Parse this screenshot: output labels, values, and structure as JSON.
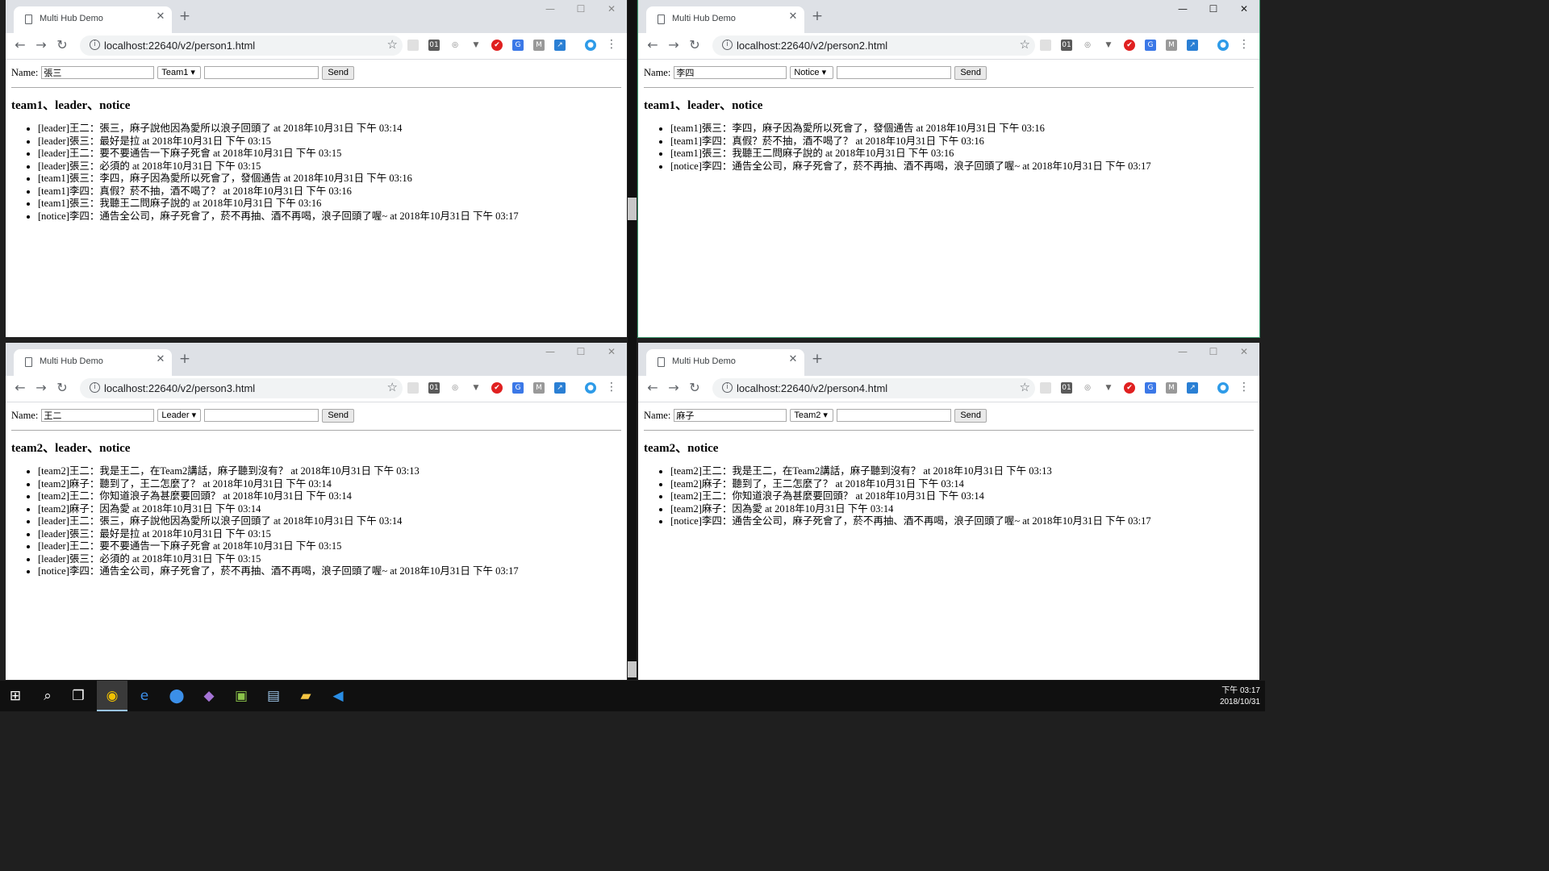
{
  "windows": [
    {
      "tab_title": "Multi Hub Demo",
      "url": "localhost:22640/v2/person1.html",
      "name_label": "Name:",
      "name_value": "張三",
      "group_selected": "Team1",
      "send_label": "Send",
      "heading": "team1、leader、notice",
      "messages": [
        "[leader]王二：張三，麻子說他因為愛所以浪子回頭了 at 2018年10月31日 下午 03:14",
        "[leader]張三：最好是拉 at 2018年10月31日 下午 03:15",
        "[leader]王二：要不要通告一下麻子死會 at 2018年10月31日 下午 03:15",
        "[leader]張三：必須的 at 2018年10月31日 下午 03:15",
        "[team1]張三：李四，麻子因為愛所以死會了，發個通告 at 2018年10月31日 下午 03:16",
        "[team1]李四：真假？菸不抽，酒不喝了？ at 2018年10月31日 下午 03:16",
        "[team1]張三：我聽王二問麻子說的 at 2018年10月31日 下午 03:16",
        "[notice]李四：通告全公司，麻子死會了，菸不再抽、酒不再喝，浪子回頭了喔~ at 2018年10月31日 下午 03:17"
      ]
    },
    {
      "tab_title": "Multi Hub Demo",
      "url": "localhost:22640/v2/person2.html",
      "name_label": "Name:",
      "name_value": "李四",
      "group_selected": "Notice",
      "send_label": "Send",
      "heading": "team1、leader、notice",
      "messages": [
        "[team1]張三：李四，麻子因為愛所以死會了，發個通告 at 2018年10月31日 下午 03:16",
        "[team1]李四：真假？菸不抽，酒不喝了？ at 2018年10月31日 下午 03:16",
        "[team1]張三：我聽王二問麻子說的 at 2018年10月31日 下午 03:16",
        "[notice]李四：通告全公司，麻子死會了，菸不再抽、酒不再喝，浪子回頭了喔~ at 2018年10月31日 下午 03:17"
      ]
    },
    {
      "tab_title": "Multi Hub Demo",
      "url": "localhost:22640/v2/person3.html",
      "name_label": "Name:",
      "name_value": "王二",
      "group_selected": "Leader",
      "send_label": "Send",
      "heading": "team2、leader、notice",
      "messages": [
        "[team2]王二：我是王二，在Team2講話，麻子聽到沒有？ at 2018年10月31日 下午 03:13",
        "[team2]麻子：聽到了，王二怎麼了？ at 2018年10月31日 下午 03:14",
        "[team2]王二：你知道浪子為甚麼要回頭？ at 2018年10月31日 下午 03:14",
        "[team2]麻子：因為愛 at 2018年10月31日 下午 03:14",
        "[leader]王二：張三，麻子說他因為愛所以浪子回頭了 at 2018年10月31日 下午 03:14",
        "[leader]張三：最好是拉 at 2018年10月31日 下午 03:15",
        "[leader]王二：要不要通告一下麻子死會 at 2018年10月31日 下午 03:15",
        "[leader]張三：必須的 at 2018年10月31日 下午 03:15",
        "[notice]李四：通告全公司，麻子死會了，菸不再抽、酒不再喝，浪子回頭了喔~ at 2018年10月31日 下午 03:17"
      ]
    },
    {
      "tab_title": "Multi Hub Demo",
      "url": "localhost:22640/v2/person4.html",
      "name_label": "Name:",
      "name_value": "麻子",
      "group_selected": "Team2",
      "send_label": "Send",
      "heading": "team2、notice",
      "messages": [
        "[team2]王二：我是王二，在Team2講話，麻子聽到沒有？ at 2018年10月31日 下午 03:13",
        "[team2]麻子：聽到了，王二怎麼了？ at 2018年10月31日 下午 03:14",
        "[team2]王二：你知道浪子為甚麼要回頭？ at 2018年10月31日 下午 03:14",
        "[team2]麻子：因為愛 at 2018年10月31日 下午 03:14",
        "[notice]李四：通告全公司，麻子死會了，菸不再抽、酒不再喝，浪子回頭了喔~ at 2018年10月31日 下午 03:17"
      ]
    }
  ],
  "taskbar": {
    "apps": [
      "windows-start",
      "search",
      "task-view",
      "chrome",
      "edge",
      "maps",
      "visual-studio",
      "app-green",
      "app-blue",
      "file-explorer",
      "vscode"
    ],
    "clock_time": "下午 03:17",
    "clock_date": "2018/10/31"
  },
  "colors": {
    "accent": "#3c9a6e",
    "taskbar": "#101010",
    "tabbar": "#dee1e6"
  }
}
